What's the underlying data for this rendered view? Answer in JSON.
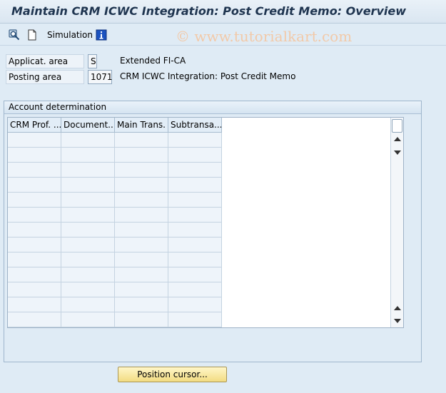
{
  "title": "Maintain CRM ICWC Integration: Post Credit Memo: Overview",
  "toolbar": {
    "simulation_label": "Simulation",
    "watermark": "© www.tutorialkart.com"
  },
  "header": {
    "applic_area_label": "Applicat. area",
    "applic_area_value": "S",
    "applic_area_desc": "Extended FI-CA",
    "posting_area_label": "Posting area",
    "posting_area_value": "1071",
    "posting_area_desc": "CRM ICWC Integration: Post Credit Memo"
  },
  "group": {
    "title": "Account determination",
    "columns": [
      "CRM Prof. ...",
      "Document...",
      "Main Trans.",
      "Subtransa..."
    ],
    "empty_rows": 13
  },
  "buttons": {
    "position_cursor": "Position cursor..."
  },
  "colors": {
    "background": "#dfebf5",
    "title_text": "#1f3550",
    "button_yellow": "#f2dc82"
  }
}
